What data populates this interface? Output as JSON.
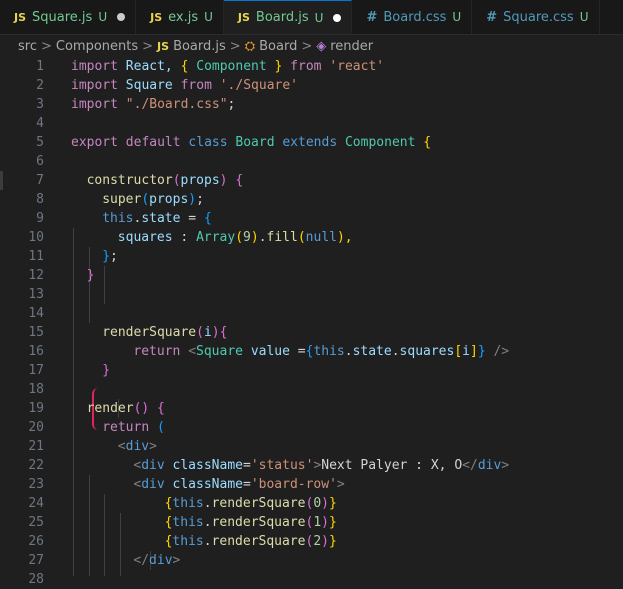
{
  "tabs": [
    {
      "icon": "JS",
      "name": "Square.js",
      "status": "U",
      "dirty": true,
      "active": false,
      "kind": "js"
    },
    {
      "icon": "JS",
      "name": "ex.js",
      "status": "U",
      "dirty": false,
      "active": false,
      "kind": "js"
    },
    {
      "icon": "JS",
      "name": "Board.js",
      "status": "U",
      "dirty": true,
      "active": true,
      "kind": "js"
    },
    {
      "icon": "#",
      "name": "Board.css",
      "status": "U",
      "dirty": false,
      "active": false,
      "kind": "css"
    },
    {
      "icon": "#",
      "name": "Square.css",
      "status": "U",
      "dirty": false,
      "active": false,
      "kind": "css"
    }
  ],
  "breadcrumb": {
    "src": "src",
    "components": "Components",
    "file_icon": "JS",
    "file": "Board.js",
    "class_name": "Board",
    "method": "render",
    "sep": ">"
  },
  "line_numbers": [
    "1",
    "2",
    "3",
    "4",
    "5",
    "6",
    "7",
    "8",
    "9",
    "10",
    "11",
    "12",
    "13",
    "14",
    "15",
    "16",
    "17",
    "18",
    "19",
    "20",
    "21",
    "22",
    "23",
    "24",
    "25",
    "26",
    "27",
    "28"
  ],
  "code": {
    "l1": [
      "import",
      " React, ",
      "{",
      " Component ",
      "}",
      " from ",
      "'react'"
    ],
    "l2": [
      "import",
      " Square ",
      "from",
      " ",
      "'./Square'"
    ],
    "l3": [
      "import",
      " ",
      "\"./Board.css\"",
      ";"
    ],
    "l5": [
      "export",
      " ",
      "default",
      " ",
      "class",
      " ",
      "Board",
      " ",
      "extends",
      " ",
      "Component",
      " ",
      "{"
    ],
    "l7": [
      "constructor",
      "(",
      "props",
      ")",
      " ",
      "{"
    ],
    "l8": [
      "super",
      "(",
      "props",
      ")",
      ";"
    ],
    "l9": [
      "this",
      ".",
      "state",
      " = ",
      "{"
    ],
    "l10": [
      "squares",
      " : ",
      "Array",
      "(",
      "9",
      ")",
      ".",
      "fill",
      "(",
      "null",
      "),"
    ],
    "l11": [
      "}",
      ";"
    ],
    "l12": [
      "}"
    ],
    "l15": [
      "renderSquare",
      "(",
      "i",
      ")",
      "{"
    ],
    "l16": [
      "return",
      " ",
      "<",
      "Square",
      " ",
      "value",
      " =",
      "{",
      "this",
      ".",
      "state",
      ".",
      "squares",
      "[",
      "i",
      "]",
      "}",
      " ",
      "/>"
    ],
    "l17": [
      "}"
    ],
    "l19": [
      "render",
      "()",
      " ",
      "{"
    ],
    "l20": [
      "return",
      " ",
      "("
    ],
    "l21": [
      "<",
      "div",
      ">"
    ],
    "l22": [
      "<",
      "div",
      " ",
      "className",
      "=",
      "'status'",
      ">",
      "Next Palyer : X, O",
      "</",
      "div",
      ">"
    ],
    "l23": [
      "<",
      "div",
      " ",
      "className",
      "=",
      "'board-row'",
      ">"
    ],
    "l24": [
      "{",
      "this",
      ".",
      "renderSquare",
      "(",
      "0",
      ")",
      "}"
    ],
    "l25": [
      "{",
      "this",
      ".",
      "renderSquare",
      "(",
      "1",
      ")",
      "}"
    ],
    "l26": [
      "{",
      "this",
      ".",
      "renderSquare",
      "(",
      "2",
      ")",
      "}"
    ],
    "l27": [
      "</",
      "div",
      ">"
    ]
  }
}
